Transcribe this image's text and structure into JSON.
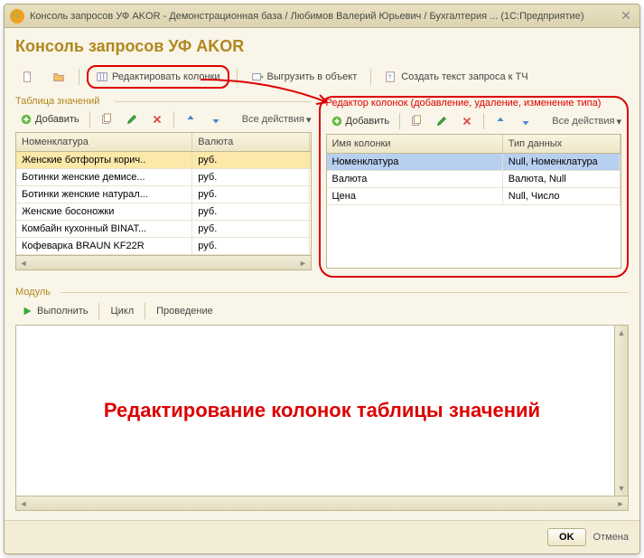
{
  "titlebar": "Консоль запросов УФ AKOR - Демонстрационная база / Любимов Валерий Юрьевич / Бухгалтерия ...   (1С:Предприятие)",
  "main_title": "Консоль запросов УФ AKOR",
  "toolbar": {
    "edit_columns": "Редактировать колонки",
    "export_obj": "Выгрузить в объект",
    "create_query": "Создать текст запроса к ТЧ"
  },
  "left": {
    "label": "Таблица значений",
    "add": "Добавить",
    "all_actions": "Все действия",
    "columns": {
      "name": "Номенклатура",
      "currency": "Валюта"
    },
    "rows": [
      {
        "name": "Женские ботфорты корич..",
        "currency": "руб."
      },
      {
        "name": "Ботинки женские демисе...",
        "currency": "руб."
      },
      {
        "name": "Ботинки женские натурал...",
        "currency": "руб."
      },
      {
        "name": "Женские босоножки",
        "currency": "руб."
      },
      {
        "name": "Комбайн кухонный BINAT...",
        "currency": "руб."
      },
      {
        "name": "Кофеварка BRAUN KF22R",
        "currency": "руб."
      }
    ]
  },
  "right": {
    "label": "Редактор колонок (добавление, удаление, изменение типа)",
    "add": "Добавить",
    "all_actions": "Все действия",
    "columns": {
      "col": "Имя колонки",
      "type": "Тип данных"
    },
    "rows": [
      {
        "col": "Номенклатура",
        "type": "Null, Номенклатура"
      },
      {
        "col": "Валюта",
        "type": "Валюта, Null"
      },
      {
        "col": "Цена",
        "type": "Null, Число"
      }
    ]
  },
  "module": {
    "label": "Модуль",
    "run": "Выполнить",
    "loop": "Цикл",
    "posting": "Проведение",
    "overlay": "Редактирование колонок таблицы значений"
  },
  "footer": {
    "ok": "OK",
    "cancel": "Отмена"
  }
}
